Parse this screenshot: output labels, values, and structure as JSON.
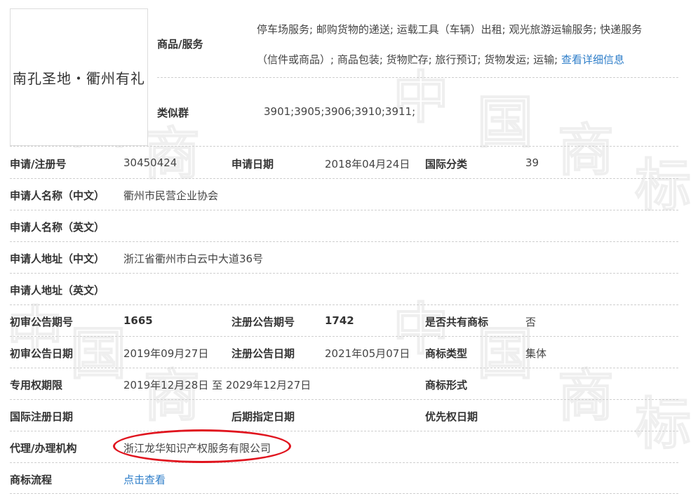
{
  "watermark": [
    "中",
    "国",
    "商",
    "标"
  ],
  "logo": {
    "text": "南孔圣地・衢州有礼"
  },
  "goods": {
    "label": "商品/服务",
    "line1": "停车场服务; 邮购货物的递送; 运载工具（车辆）出租; 观光旅游运输服务; 快递服务",
    "line2": "（信件或商品）; 商品包装; 货物贮存; 旅行预订; 货物发运; 运输;",
    "detail_link": "查看详细信息"
  },
  "similar_group": {
    "label": "类似群",
    "value": "3901;3905;3906;3910;3911;"
  },
  "fields": {
    "reg_no_label": "申请/注册号",
    "reg_no": "30450424",
    "app_date_label": "申请日期",
    "app_date": "2018年04月24日",
    "intl_class_label": "国际分类",
    "intl_class": "39",
    "applicant_cn_label": "申请人名称（中文）",
    "applicant_cn": "衢州市民营企业协会",
    "applicant_en_label": "申请人名称（英文）",
    "address_cn_label": "申请人地址（中文）",
    "address_cn": "浙江省衢州市白云中大道36号",
    "address_en_label": "申请人地址（英文）",
    "prelim_pub_no_label": "初审公告期号",
    "prelim_pub_no": "1665",
    "reg_pub_no_label": "注册公告期号",
    "reg_pub_no": "1742",
    "shared_label": "是否共有商标",
    "shared": "否",
    "prelim_pub_date_label": "初审公告日期",
    "prelim_pub_date": "2019年09月27日",
    "reg_pub_date_label": "注册公告日期",
    "reg_pub_date": "2021年05月07日",
    "tm_type_label": "商标类型",
    "tm_type": "集体",
    "exclusive_label": "专用权期限",
    "exclusive": "2019年12月28日 至 2029年12月27日",
    "tm_form_label": "商标形式",
    "intl_reg_date_label": "国际注册日期",
    "later_date_label": "后期指定日期",
    "priority_date_label": "优先权日期",
    "agent_label": "代理/办理机构",
    "agent": "浙江龙华知识产权服务有限公司",
    "process_label": "商标流程",
    "process_link": "点击查看"
  },
  "colors": {
    "link": "#2e7ec9",
    "highlight_oval": "#e0141e"
  }
}
